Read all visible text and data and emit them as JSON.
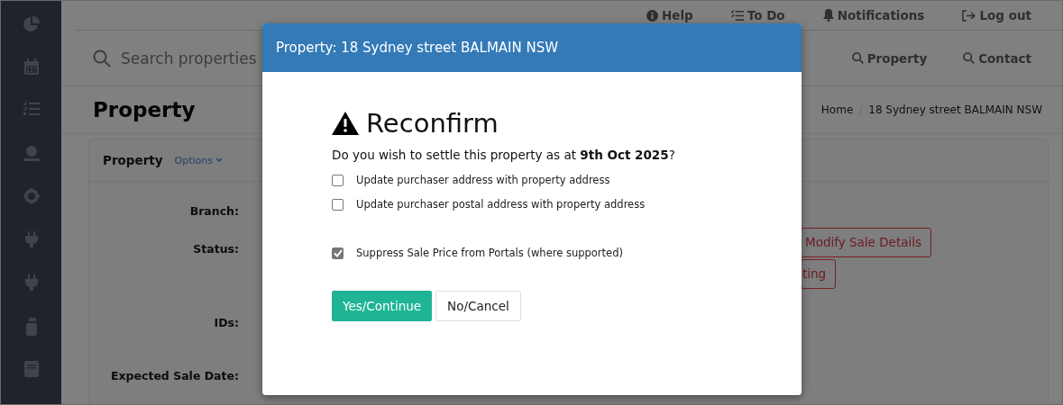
{
  "top_nav": [
    {
      "kind": "help",
      "label": "Help"
    },
    {
      "kind": "todo",
      "label": "To Do"
    },
    {
      "kind": "bell",
      "label": "Notifications"
    },
    {
      "kind": "logout",
      "label": "Log out"
    }
  ],
  "sidebar": {
    "items": [
      {
        "kind": "pie"
      },
      {
        "kind": "calendar"
      },
      {
        "kind": "tasks"
      },
      {
        "kind": "money"
      },
      {
        "kind": "gear"
      },
      {
        "kind": "plug"
      },
      {
        "kind": "plug"
      },
      {
        "kind": "bottle"
      },
      {
        "kind": "book"
      }
    ]
  },
  "search": {
    "placeholder": "Search properties",
    "scopes": [
      "Property",
      "Contact"
    ]
  },
  "page_title": "Property",
  "breadcrumb": [
    "Home",
    "18 Sydney street BALMAIN NSW"
  ],
  "card": {
    "title": "Property",
    "options": "Options",
    "fields": [
      {
        "label": "Branch:"
      },
      {
        "label": "Status:",
        "buttons": [
          "Modify Sale Details",
          "ting"
        ]
      },
      {
        "label": "IDs:"
      },
      {
        "label": "Expected Sale Date:"
      }
    ]
  },
  "modal": {
    "title": "Property: 18 Sydney street BALMAIN NSW",
    "heading": "Reconfirm",
    "question": "Do you wish to settle this property as at **9th Oct 2025**?",
    "option_groups": [
      [
        {
          "label": "Update purchaser address with property address",
          "checked": false
        },
        {
          "label": "Update purchaser postal address with property address",
          "checked": false
        }
      ],
      [
        {
          "label": "Suppress Sale Price from Portals (where supported)",
          "checked": true
        }
      ]
    ],
    "buttons": [
      {
        "kind": "primary",
        "label": "Yes/Continue"
      },
      {
        "kind": "default",
        "label": "No/Cancel"
      }
    ]
  }
}
